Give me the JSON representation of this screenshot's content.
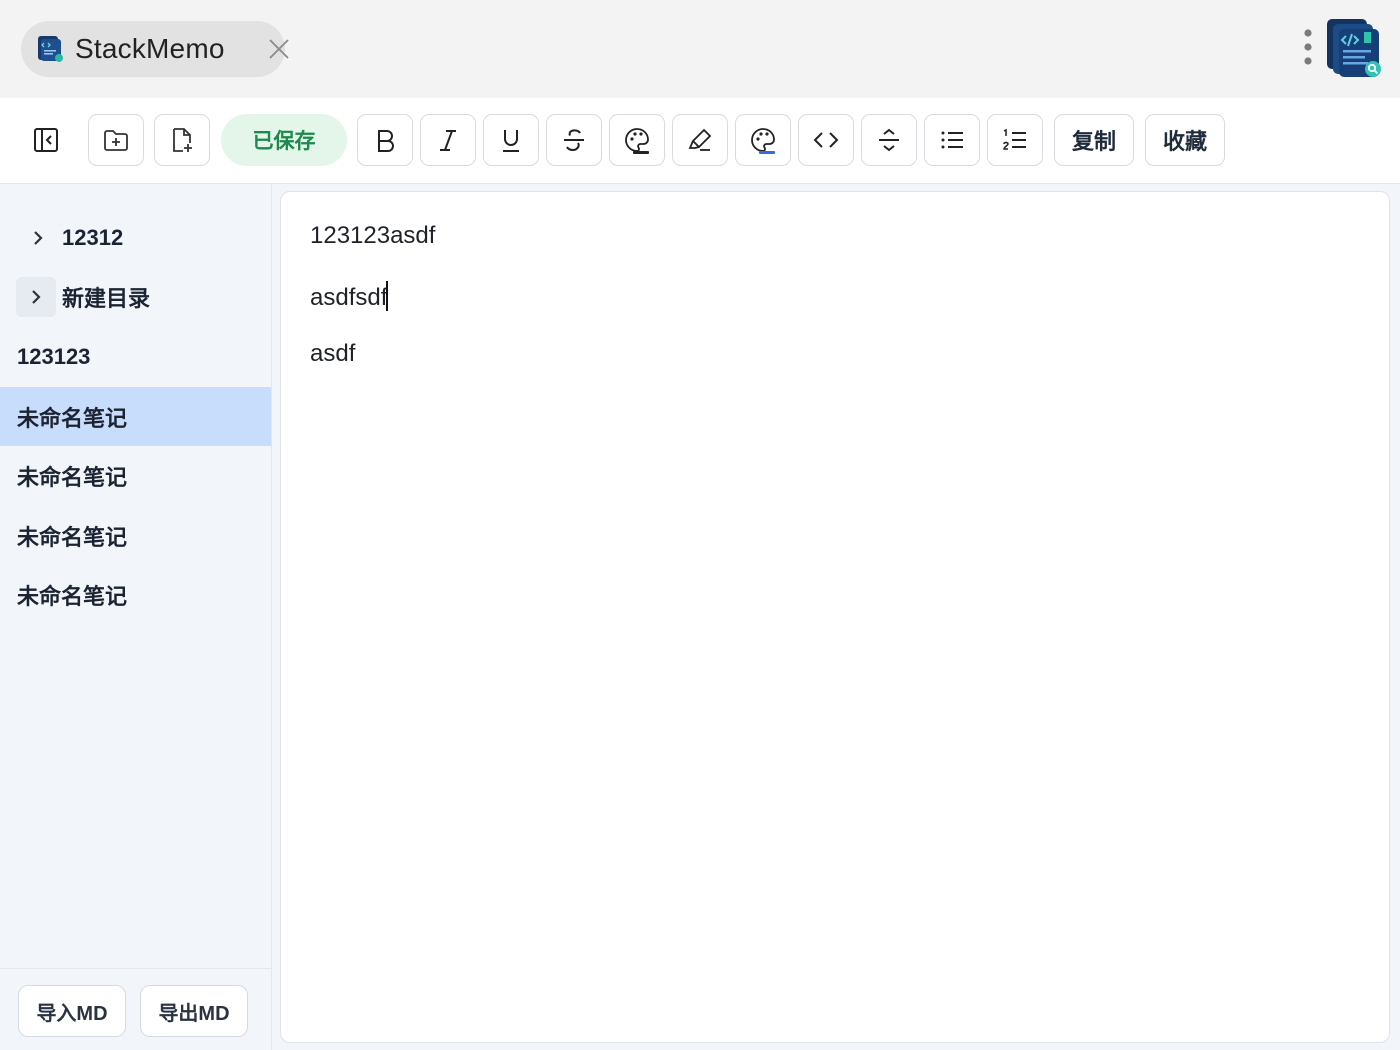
{
  "window": {
    "tab_title": "StackMemo",
    "tab_icon": "stackmemo-app-icon",
    "close_icon": "close-icon",
    "menu_icon": "more-vertical-icon",
    "logo_icon": "stackmemo-logo-icon"
  },
  "toolbar": {
    "toggle_sidebar_icon": "sidebar-collapse-icon",
    "new_folder_icon": "folder-plus-icon",
    "new_note_icon": "file-plus-icon",
    "saved_status": "已保存",
    "bold_icon": "bold-icon",
    "italic_icon": "italic-icon",
    "underline_icon": "underline-icon",
    "strikethrough_icon": "strikethrough-icon",
    "text_color_icon": "palette-icon",
    "highlight_icon": "highlighter-icon",
    "bg_color_icon": "palette-fill-icon",
    "code_icon": "code-icon",
    "divider_icon": "horizontal-rule-icon",
    "bullet_list_icon": "bullet-list-icon",
    "ordered_list_icon": "ordered-list-icon",
    "copy_label": "复制",
    "favorite_label": "收藏"
  },
  "sidebar": {
    "items": [
      {
        "label": "12312",
        "type": "folder",
        "expanded": false
      },
      {
        "label": "新建目录",
        "type": "folder",
        "expanded": false
      },
      {
        "label": "123123",
        "type": "note"
      },
      {
        "label": "未命名笔记",
        "type": "note",
        "selected": true
      },
      {
        "label": "未命名笔记",
        "type": "note"
      },
      {
        "label": "未命名笔记",
        "type": "note"
      },
      {
        "label": "未命名笔记",
        "type": "note"
      }
    ],
    "import_label": "导入MD",
    "export_label": "导出MD"
  },
  "editor": {
    "lines": [
      "123123asdf",
      "asdfsdf",
      "asdf"
    ]
  },
  "colors": {
    "accent": "#c8dcfb",
    "saved_bg": "#e4f6ea",
    "saved_text": "#1c8a4c",
    "sidebar_bg": "#f2f6fb"
  }
}
